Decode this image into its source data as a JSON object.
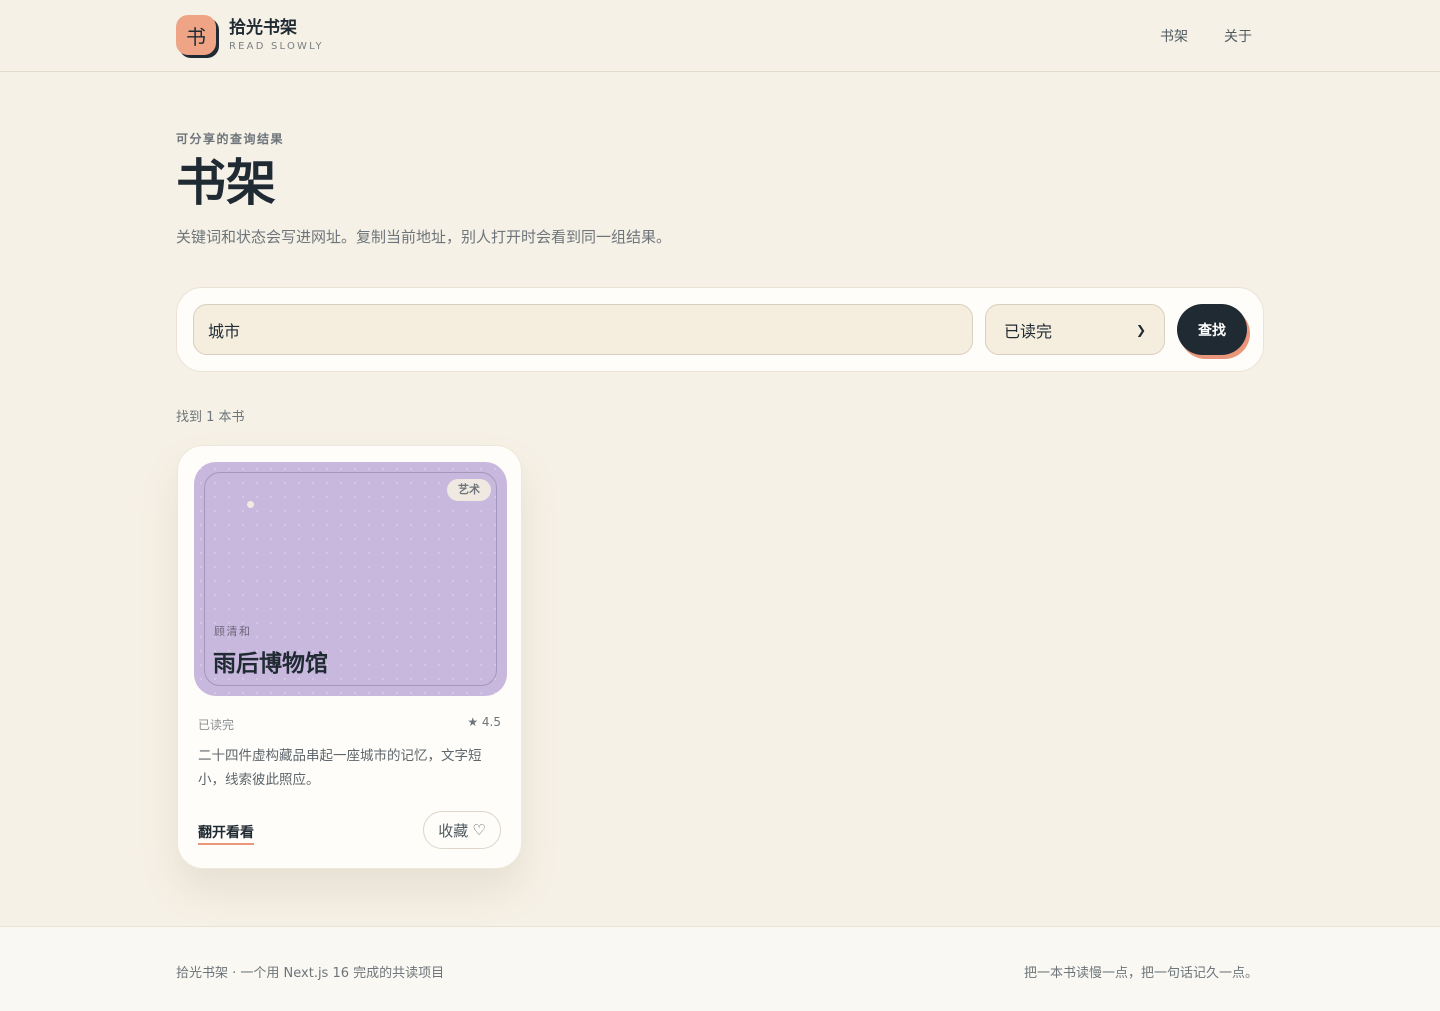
{
  "header": {
    "logo_glyph": "书",
    "brand_name": "拾光书架",
    "brand_sub": "READ SLOWLY",
    "nav": [
      {
        "label": "书架"
      },
      {
        "label": "关于"
      }
    ]
  },
  "intro": {
    "eyebrow": "可分享的查询结果",
    "title": "书架",
    "description": "关键词和状态会写进网址。复制当前地址，别人打开时会看到同一组结果。"
  },
  "search": {
    "query_value": "城市",
    "status_selected": "已读完",
    "submit_label": "查找"
  },
  "results": {
    "count_text": "找到 1 本书",
    "books": [
      {
        "genre": "艺术",
        "author": "顾清和",
        "title": "雨后博物馆",
        "status": "已读完",
        "rating": "★ 4.5",
        "blurb": "二十四件虚构藏品串起一座城市的记忆，文字短小，线索彼此照应。",
        "open_label": "翻开看看",
        "favorite_label": "收藏",
        "favorite_icon": "♡",
        "cover_color": "#c9b8de"
      }
    ]
  },
  "footer": {
    "left": "拾光书架 · 一个用 Next.js 16 完成的共读项目",
    "right": "把一本书读慢一点，把一句话记久一点。"
  },
  "colors": {
    "background": "#f6f1e6",
    "ink": "#1f2a33",
    "accent": "#e9967a"
  }
}
